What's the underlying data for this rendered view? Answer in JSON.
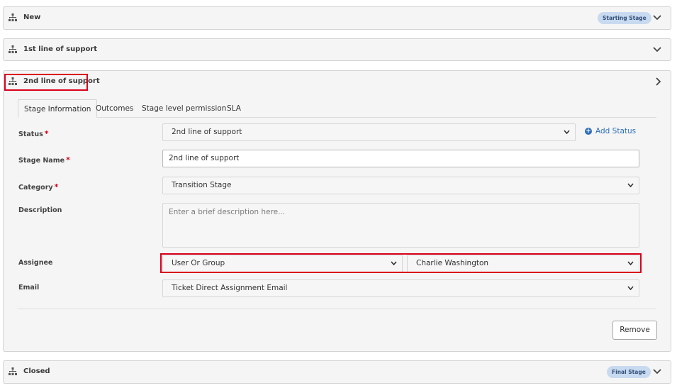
{
  "stages": [
    {
      "title": "New",
      "badge": "Starting Stage"
    },
    {
      "title": "1st line of support"
    },
    {
      "title": "2nd line of support"
    },
    {
      "title": "Closed",
      "badge": "Final Stage"
    }
  ],
  "tabs": [
    "Stage Information",
    "Outcomes",
    "Stage level permission",
    "SLA"
  ],
  "form": {
    "status_label": "Status",
    "status_value": "2nd line of support",
    "add_status": "Add Status",
    "stage_name_label": "Stage Name",
    "stage_name_value": "2nd line of support",
    "category_label": "Category",
    "category_value": "Transition Stage",
    "description_label": "Description",
    "description_placeholder": "Enter a brief description here...",
    "assignee_label": "Assignee",
    "assignee_type": "User Or Group",
    "assignee_value": "Charlie Washington",
    "email_label": "Email",
    "email_value": "Ticket Direct Assignment Email",
    "required_mark": "*",
    "remove_label": "Remove"
  },
  "colors": {
    "required": "#d9001b",
    "highlight": "#d9001b",
    "link": "#2f6fb6",
    "badge_bg": "#c8daf0"
  },
  "icons": {
    "stage": "hierarchy-icon",
    "expand": "chevron-down-icon",
    "collapse": "chevron-right-icon",
    "add": "plus-circle-icon"
  }
}
